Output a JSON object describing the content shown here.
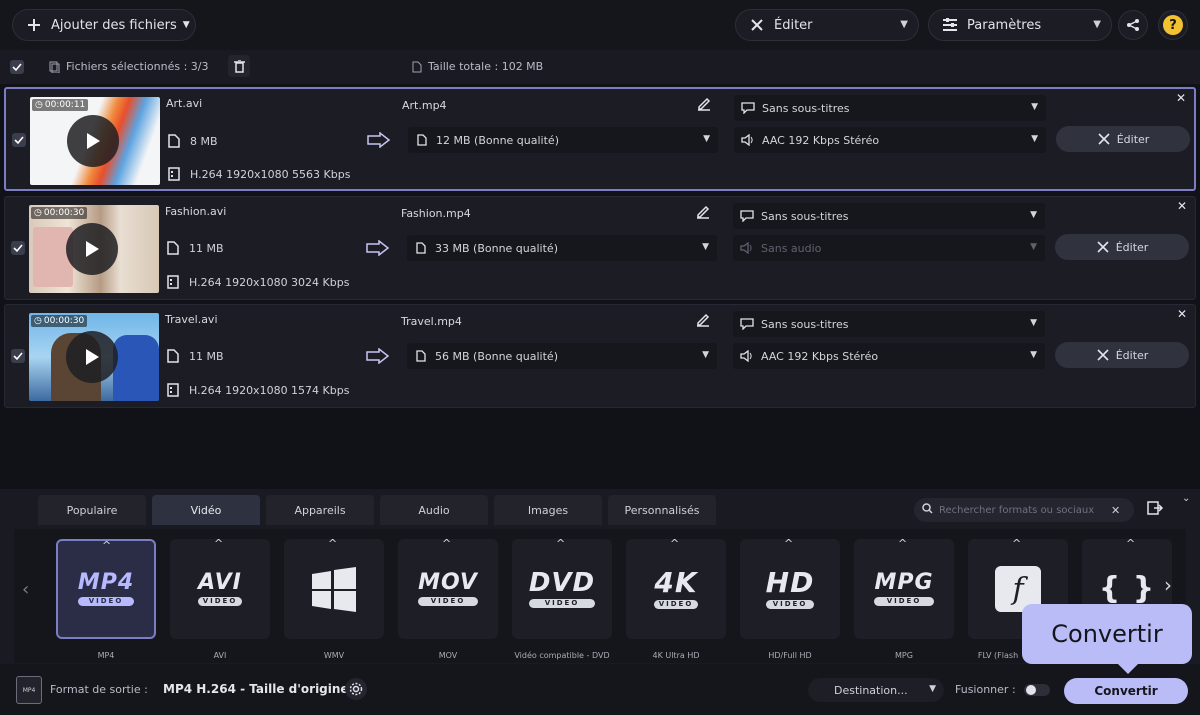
{
  "toolbar": {
    "add_files": "Ajouter des fichiers",
    "edit": "Éditer",
    "settings": "Paramètres"
  },
  "selection": {
    "selected_label": "Fichiers sélectionnés : 3/3",
    "total_size": "Taille totale : 102 MB"
  },
  "files": [
    {
      "duration": "00:00:11",
      "name": "Art.avi",
      "size": "8 MB",
      "codec": "H.264 1920x1080 5563 Kbps",
      "output_name": "Art.mp4",
      "output_size": "12 MB (Bonne qualité)",
      "subtitles": "Sans sous-titres",
      "audio": "AAC 192 Kbps Stéréo",
      "edit_label": "Éditer"
    },
    {
      "duration": "00:00:30",
      "name": "Fashion.avi",
      "size": "11 MB",
      "codec": "H.264 1920x1080 3024 Kbps",
      "output_name": "Fashion.mp4",
      "output_size": "33 MB (Bonne qualité)",
      "subtitles": "Sans sous-titres",
      "audio": "Sans audio",
      "edit_label": "Éditer"
    },
    {
      "duration": "00:00:30",
      "name": "Travel.avi",
      "size": "11 MB",
      "codec": "H.264 1920x1080 1574 Kbps",
      "output_name": "Travel.mp4",
      "output_size": "56 MB (Bonne qualité)",
      "subtitles": "Sans sous-titres",
      "audio": "AAC 192 Kbps Stéréo",
      "edit_label": "Éditer"
    }
  ],
  "tabs": [
    "Populaire",
    "Vidéo",
    "Appareils",
    "Audio",
    "Images",
    "Personnalisés"
  ],
  "active_tab": "Vidéo",
  "search_placeholder": "Rechercher formats ou sociaux",
  "formats": [
    {
      "logo": "MP4",
      "sub": "VIDEO",
      "label": "MP4"
    },
    {
      "logo": "AVI",
      "sub": "VIDEO",
      "label": "AVI"
    },
    {
      "logo": "",
      "sub": "",
      "label": "WMV"
    },
    {
      "logo": "MOV",
      "sub": "VIDEO",
      "label": "MOV"
    },
    {
      "logo": "DVD",
      "sub": "VIDEO",
      "label": "Vidéo compatible - DVD"
    },
    {
      "logo": "4K",
      "sub": "VIDEO",
      "label": "4K Ultra HD"
    },
    {
      "logo": "HD",
      "sub": "VIDEO",
      "label": "HD/Full HD"
    },
    {
      "logo": "MPG",
      "sub": "VIDEO",
      "label": "MPG"
    },
    {
      "logo": "",
      "sub": "",
      "label": "FLV (Flash"
    },
    {
      "logo": "{ }",
      "sub": "",
      "label": ""
    }
  ],
  "footer": {
    "output_label": "Format de sortie :",
    "output_value": "MP4 H.264 - Taille d'origine",
    "destination": "Destination...",
    "merge": "Fusionner :",
    "convert": "Convertir",
    "tooltip": "Convertir"
  },
  "colors": {
    "accent": "#b9bcf7",
    "selected_border": "#7b7ec4",
    "background": "#111217"
  }
}
